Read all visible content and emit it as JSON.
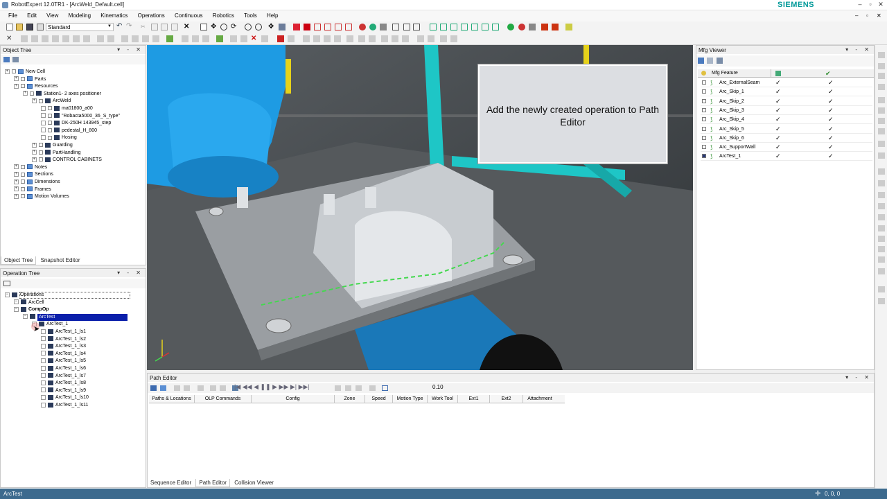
{
  "window": {
    "title": "RobotExpert 12.0TR1 - [ArcWeld_Default.cell]",
    "brand": "SIEMENS"
  },
  "menu": [
    "File",
    "Edit",
    "View",
    "Modeling",
    "Kinematics",
    "Operations",
    "Continuous",
    "Robotics",
    "Tools",
    "Help"
  ],
  "toolbar": {
    "combo_value": "Standard"
  },
  "object_tree": {
    "title": "Object Tree",
    "items": [
      {
        "label": "New Cell",
        "level": 0,
        "icon": "folder"
      },
      {
        "label": "Parts",
        "level": 1,
        "icon": "folder"
      },
      {
        "label": "Resources",
        "level": 1,
        "icon": "folder"
      },
      {
        "label": "Station1- 2 axes positioner",
        "level": 2,
        "icon": "robot"
      },
      {
        "label": "ArcWeld",
        "level": 3,
        "icon": "robot"
      },
      {
        "label": "ma01800_a00",
        "level": 4,
        "icon": "gear"
      },
      {
        "label": "\"Robacta5000_36_S_type\"",
        "level": 4,
        "icon": "part"
      },
      {
        "label": "DK-250H 143945_step",
        "level": 4,
        "icon": "part"
      },
      {
        "label": "pedestal_H_800",
        "level": 4,
        "icon": "gear"
      },
      {
        "label": "Hosing",
        "level": 4,
        "icon": "robot"
      },
      {
        "label": "Guarding",
        "level": 3,
        "icon": "robot"
      },
      {
        "label": "PartHandling",
        "level": 3,
        "icon": "robot"
      },
      {
        "label": "CONTROL CABINETS",
        "level": 3,
        "icon": "robot"
      },
      {
        "label": "Notes",
        "level": 1,
        "icon": "folder"
      },
      {
        "label": "Sections",
        "level": 1,
        "icon": "folder"
      },
      {
        "label": "Dimensions",
        "level": 1,
        "icon": "folder"
      },
      {
        "label": "Frames",
        "level": 1,
        "icon": "folder"
      },
      {
        "label": "Motion Volumes",
        "level": 1,
        "icon": "folder"
      }
    ],
    "tabs": [
      "Object Tree",
      "Snapshot Editor"
    ]
  },
  "operation_tree": {
    "title": "Operation Tree",
    "items": [
      {
        "label": "Operations",
        "level": 0
      },
      {
        "label": "ArcCell",
        "level": 1
      },
      {
        "label": "CompOp",
        "level": 1
      },
      {
        "label": "ArcTest",
        "level": 2
      },
      {
        "label": "ArcTest_1",
        "level": 3
      },
      {
        "label": "ArcTest_1_ls1",
        "level": 4
      },
      {
        "label": "ArcTest_1_ls2",
        "level": 4
      },
      {
        "label": "ArcTest_1_ls3",
        "level": 4
      },
      {
        "label": "ArcTest_1_ls4",
        "level": 4
      },
      {
        "label": "ArcTest_1_ls5",
        "level": 4
      },
      {
        "label": "ArcTest_1_ls6",
        "level": 4
      },
      {
        "label": "ArcTest_1_ls7",
        "level": 4
      },
      {
        "label": "ArcTest_1_ls8",
        "level": 4
      },
      {
        "label": "ArcTest_1_ls9",
        "level": 4
      },
      {
        "label": "ArcTest_1_ls10",
        "level": 4
      },
      {
        "label": "ArcTest_1_ls11",
        "level": 4
      }
    ]
  },
  "callout": {
    "text": "Add the newly created operation to Path Editor"
  },
  "mfg_viewer": {
    "title": "Mfg Viewer",
    "header": "Mfg Feature",
    "rows": [
      "Arc_ExternalSeam",
      "Arc_Skip_1",
      "Arc_Skip_2",
      "Arc_Skip_3",
      "Arc_Skip_4",
      "Arc_Skip_5",
      "Arc_Skip_6",
      "Arc_SupportWall",
      "ArcTest_1"
    ],
    "check": "✓"
  },
  "path_editor": {
    "title": "Path Editor",
    "speed_value": "0.10",
    "columns": [
      "Paths & Locations",
      "OLP Commands",
      "Config",
      "Zone",
      "Speed",
      "Motion Type",
      "Work Tool",
      "Ext1",
      "Ext2",
      "Attachment"
    ],
    "tabs": [
      "Sequence Editor",
      "Path Editor",
      "Collision Viewer"
    ]
  },
  "status": {
    "left": "ArcTest",
    "right": "0, 0, 0"
  },
  "colors": {
    "accent": "#009999",
    "selection": "#0a1faa",
    "robot": "#1e9be3",
    "status": "#3c6a8e"
  }
}
